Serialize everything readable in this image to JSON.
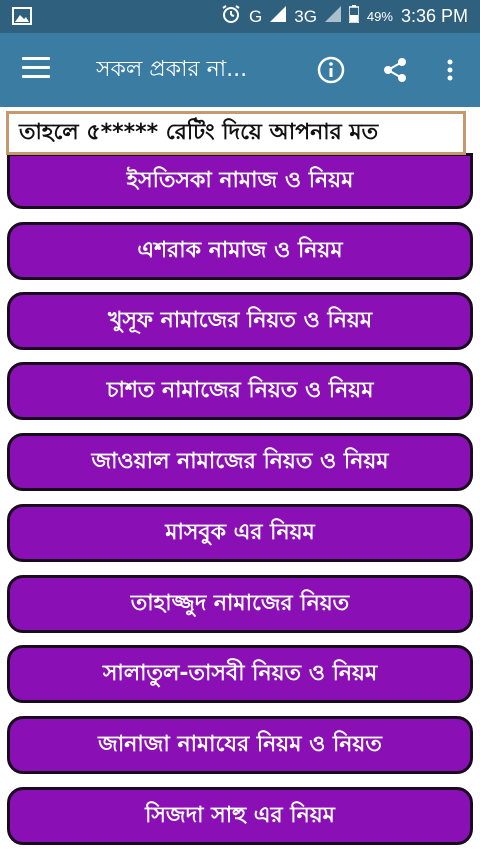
{
  "status_bar": {
    "network": "G",
    "network2": "3G",
    "battery": "49%",
    "time": "3:36 PM"
  },
  "app_bar": {
    "title": "সকল প্রকার না...",
    "color": "#3b7ca3"
  },
  "marquee": {
    "text": "তাহলে ৫***** রেটিং দিয়ে আপনার মত"
  },
  "list": {
    "items": [
      {
        "label": "ইসতিসকা নামাজ ও নিয়ম"
      },
      {
        "label": "এশরাক নামাজ ও নিয়ম"
      },
      {
        "label": "খুসূফ নামাজের নিয়ত ও নিয়ম"
      },
      {
        "label": "চাশত নামাজের নিয়ত ও নিয়ম"
      },
      {
        "label": "জাওয়াল নামাজের নিয়ত ও নিয়ম"
      },
      {
        "label": "মাসবুক এর নিয়ম"
      },
      {
        "label": "তাহাজ্জুদ নামাজের নিয়ত"
      },
      {
        "label": "সালাতুল-তাসবী নিয়ত ও নিয়ম"
      },
      {
        "label": "জানাজা  নামাযের নিয়ম ও নিয়ত"
      },
      {
        "label": "সিজদা সাহু এর নিয়ম"
      }
    ],
    "item_color": "#8a0fb5"
  }
}
